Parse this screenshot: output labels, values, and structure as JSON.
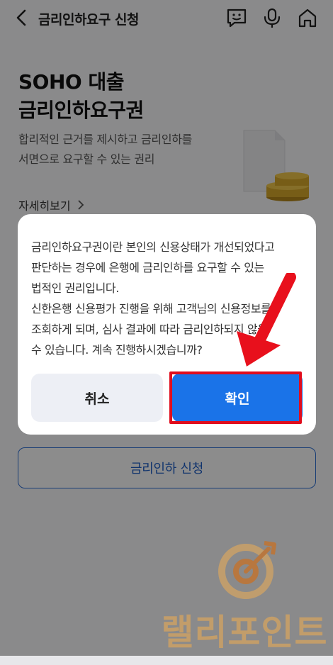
{
  "header": {
    "title": "금리인하요구 신청",
    "icons": [
      "back-icon",
      "chatbot-icon",
      "microphone-icon",
      "home-icon"
    ]
  },
  "hero": {
    "title_line1": "SOHO 대출",
    "title_line2": "금리인하요구권",
    "desc_line1": "합리적인 근거를 제시하고 금리인하를",
    "desc_line2": "서면으로 요구할 수 있는 권리",
    "more_link": "자세히보기"
  },
  "apply_button": "금리인하 신청",
  "dialog": {
    "lines": [
      "금리인하요구권이란 본인의 신용상태가 개선되었다고",
      "판단하는 경우에 은행에 금리인하를 요구할 수 있는",
      "법적인 권리입니다.",
      "신한은행 신용평가 진행을 위해 고객님의 신용정보를",
      "조회하게 되며, 심사 결과에 따라 금리인하되지 않을",
      "수 있습니다. 계속 진행하시겠습니까?"
    ],
    "cancel_label": "취소",
    "confirm_label": "확인"
  },
  "watermark": "랠리포인트",
  "colors": {
    "accent": "#1a73e8",
    "highlight": "#e00d1d",
    "watermark": "#c9a067"
  }
}
